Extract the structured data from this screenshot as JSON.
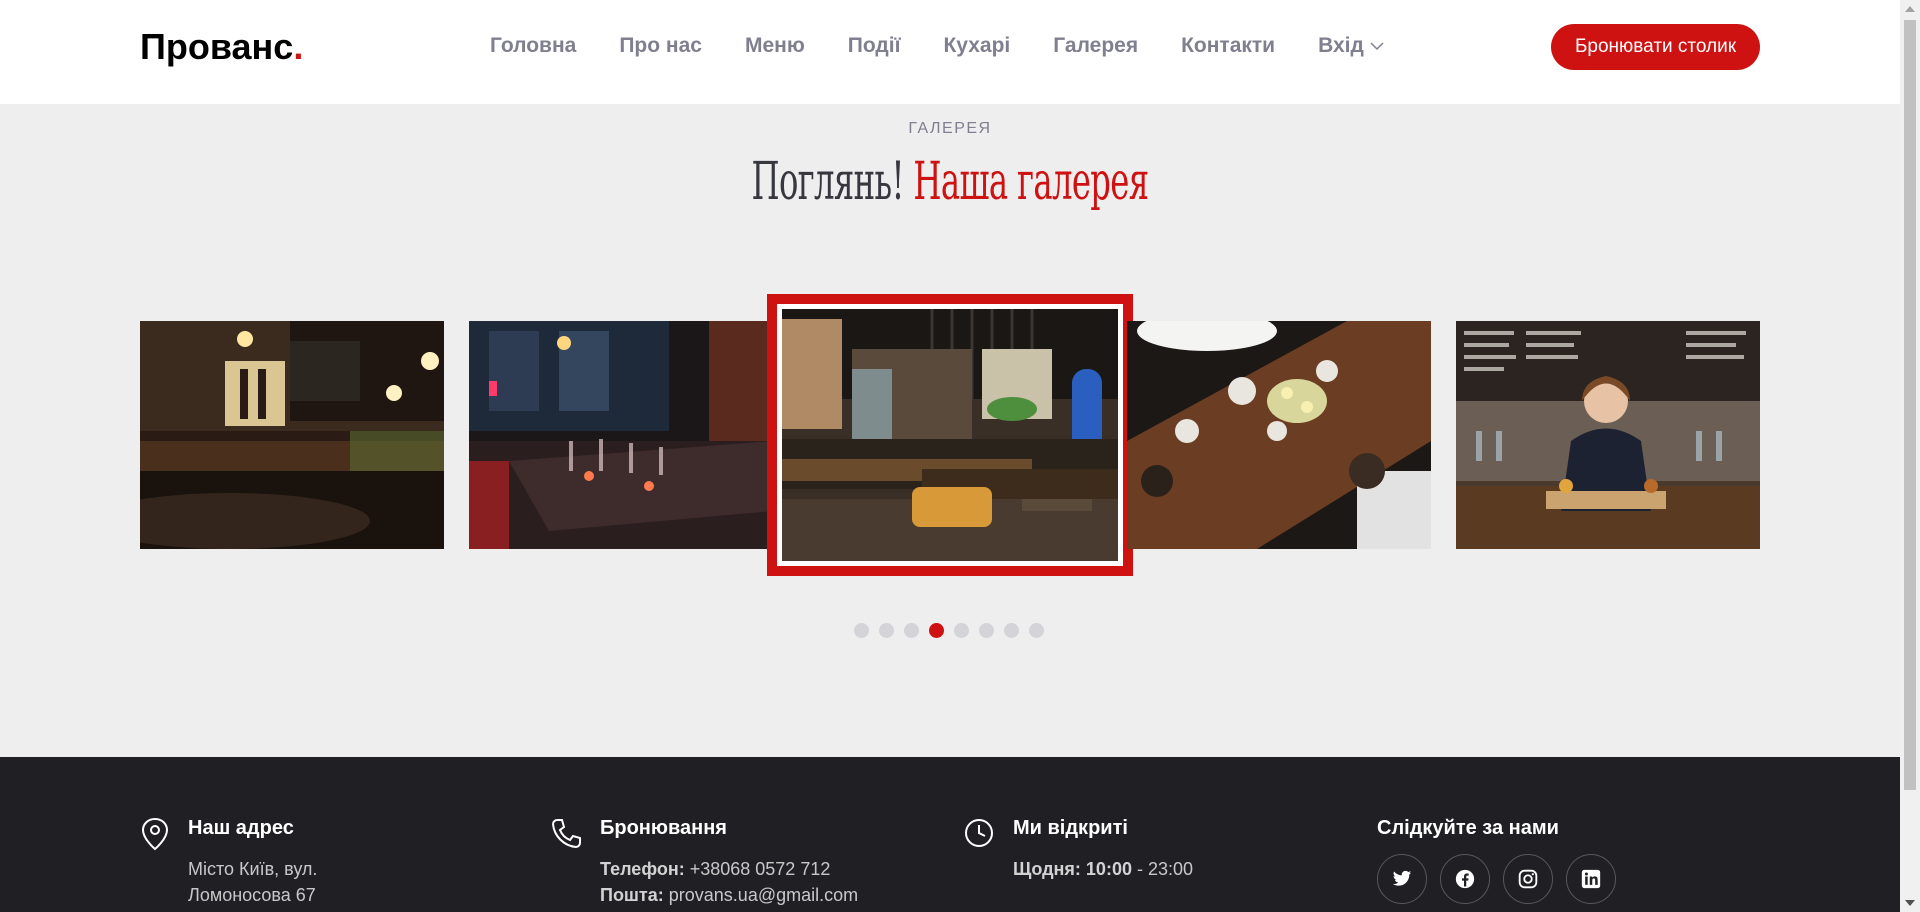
{
  "header": {
    "logo_text": "Прованс",
    "logo_dot": ".",
    "nav": [
      "Головна",
      "Про нас",
      "Меню",
      "Події",
      "Кухарі",
      "Галерея",
      "Контакти"
    ],
    "login_label": "Вхід",
    "book_button": "Бронювати столик"
  },
  "gallery": {
    "subtitle": "ГАЛЕРЕЯ",
    "title_main": "Поглянь!",
    "title_accent": "Наша галерея",
    "slides": [
      "restaurant-interior-photo",
      "dining-table-wineglasses-photo",
      "cafe-bar-interior-photo",
      "overhead-table-dinner-photo",
      "bartender-woman-photo"
    ],
    "dots_count": 8,
    "active_dot": 4
  },
  "footer": {
    "address": {
      "heading": "Наш адрес",
      "line1": "Місто Київ, вул.",
      "line2": "Ломоносова 67"
    },
    "booking": {
      "heading": "Бронювання",
      "phone_label": "Телефон:",
      "phone": " +38068 0572 712",
      "email_label": "Пошта:",
      "email": " provans.ua@gmail.com"
    },
    "hours": {
      "heading": "Ми відкриті",
      "days_label": "Щодня:",
      "open": "10:00",
      "close": " - 23:00"
    },
    "social": {
      "heading": "Слідкуйте за нами",
      "icons": [
        "twitter-icon",
        "facebook-icon",
        "instagram-icon",
        "linkedin-icon"
      ]
    }
  },
  "colors": {
    "accent": "#ce1212",
    "section_bg": "#eeeeee",
    "footer_bg": "#202024"
  }
}
